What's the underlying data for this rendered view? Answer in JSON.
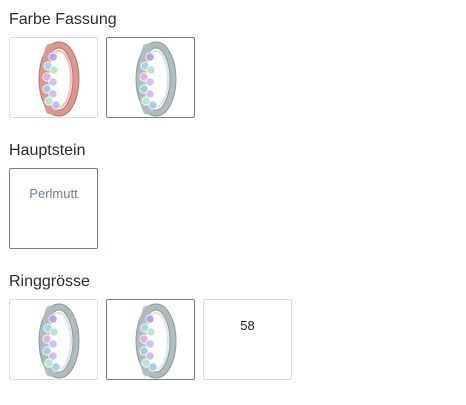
{
  "sections": {
    "frame_color": {
      "label": "Farbe Fassung",
      "options": [
        {
          "name": "rosegold",
          "color": "#d99a8e",
          "selected": false
        },
        {
          "name": "silver",
          "color": "#aebcbc",
          "selected": true
        }
      ]
    },
    "main_stone": {
      "label": "Hauptstein",
      "options": [
        {
          "value": "Perlmutt",
          "selected": true
        }
      ]
    },
    "ring_size": {
      "label": "Ringgrösse",
      "options": [
        {
          "name": "silver-ring-1",
          "selected": false
        },
        {
          "name": "silver-ring-2",
          "selected": true
        },
        {
          "value": "58",
          "selected": false
        }
      ]
    }
  },
  "colors": {
    "rosegold": "#d99a8e",
    "silver": "#aebcbc",
    "selected_border": "#6f7f90",
    "default_border": "#dcdcdc"
  }
}
